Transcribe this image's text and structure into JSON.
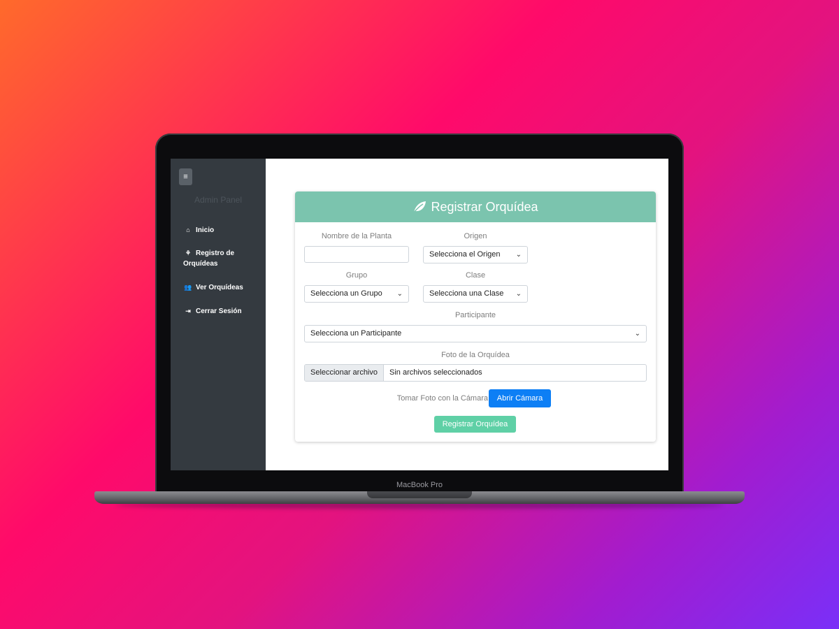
{
  "device": {
    "brand_label": "MacBook Pro"
  },
  "sidebar": {
    "toggle_glyph": "≡",
    "title": "Admin Panel",
    "items": [
      {
        "icon": "home-icon",
        "glyph": "⌂",
        "label": "Inicio"
      },
      {
        "icon": "seedling-icon",
        "glyph": "⚘",
        "label": "Registro de Orquídeas"
      },
      {
        "icon": "users-icon",
        "glyph": "👥",
        "label": "Ver Orquídeas"
      },
      {
        "icon": "sign-out-icon",
        "glyph": "⇥",
        "label": "Cerrar Sesión"
      }
    ]
  },
  "form": {
    "header": {
      "icon": "leaf-icon",
      "title": "Registrar Orquídea"
    },
    "fields": {
      "plant_name": {
        "label": "Nombre de la Planta",
        "value": ""
      },
      "origin": {
        "label": "Origen",
        "selected": "Selecciona el Origen"
      },
      "group": {
        "label": "Grupo",
        "selected": "Selecciona un Grupo"
      },
      "class": {
        "label": "Clase",
        "selected": "Selecciona una Clase"
      },
      "participant": {
        "label": "Participante",
        "selected": "Selecciona un Participante"
      },
      "photo": {
        "label": "Foto de la Orquídea",
        "button": "Seleccionar archivo",
        "status": "Sin archivos seleccionados"
      }
    },
    "camera": {
      "label": "Tomar Foto con la Cámara",
      "button": "Abrir Cámara"
    },
    "submit": "Registrar Orquídea"
  },
  "colors": {
    "header_green": "#7bc4ae",
    "submit_green": "#5fd0a6",
    "camera_blue": "#0d7ff5",
    "sidebar_dark": "#343a40"
  }
}
